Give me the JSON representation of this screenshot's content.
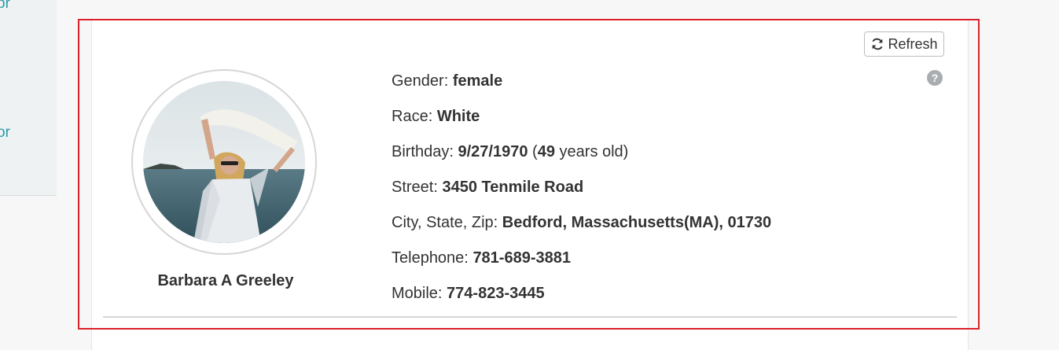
{
  "sidebar": {
    "link_1": "or",
    "link_2": "or"
  },
  "toolbar": {
    "refresh_label": "Refresh",
    "help_symbol": "?"
  },
  "profile": {
    "name": "Barbara A Greeley",
    "gender_label": "Gender:",
    "gender": "female",
    "race_label": "Race:",
    "race": "White",
    "birthday_label": "Birthday:",
    "birthday": "9/27/1970",
    "age_open": "(",
    "age": "49",
    "age_suffix": "years old)",
    "street_label": "Street:",
    "street": "3450 Tenmile Road",
    "city_label": "City, State, Zip:",
    "city": "Bedford, Massachusetts(MA), 01730",
    "telephone_label": "Telephone:",
    "telephone": "781-689-3881",
    "mobile_label": "Mobile:",
    "mobile": "774-823-3445"
  },
  "colors": {
    "accent": "#2a9aa6",
    "highlight_border": "#d9222a",
    "help_icon": "#a9adb1"
  },
  "icons": {
    "refresh": "refresh-icon",
    "help": "help-icon",
    "avatar": "avatar"
  }
}
